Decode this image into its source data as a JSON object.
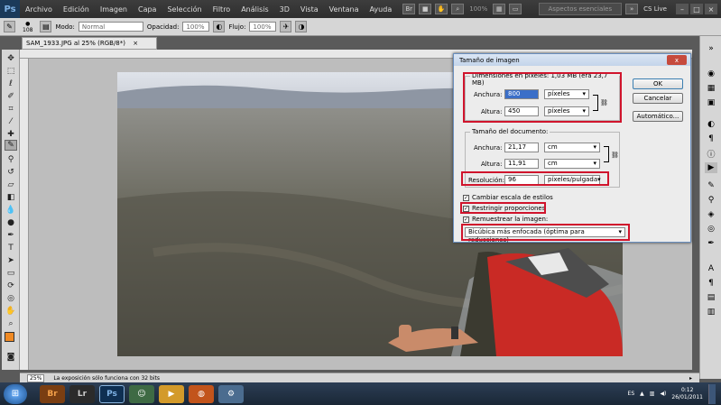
{
  "menu": {
    "app_logo": "Ps",
    "items": [
      "Archivo",
      "Edición",
      "Imagen",
      "Capa",
      "Selección",
      "Filtro",
      "Análisis",
      "3D",
      "Vista",
      "Ventana",
      "Ayuda"
    ],
    "zoom_readout": "100%",
    "workspace": "Aspectos esenciales",
    "cs_live": "CS Live"
  },
  "options": {
    "brush_size": "108",
    "mode_label": "Modo:",
    "mode_value": "Normal",
    "opacity_label": "Opacidad:",
    "opacity_value": "100%",
    "flow_label": "Flujo:",
    "flow_value": "100%"
  },
  "document": {
    "tab_title": "SAM_1933.JPG al 25% (RGB/8*)",
    "tab_close": "×"
  },
  "status": {
    "zoom": "25%",
    "message": "La exposición sólo funciona con 32 bits"
  },
  "dialog": {
    "title": "Tamaño de imagen",
    "close": "x",
    "pixel_dims_label": "Dimensiones en píxeles:",
    "pixel_dims_value": "1,03 MB (era 23,7 MB)",
    "px_width_label": "Anchura:",
    "px_width_value": "800",
    "px_width_unit": "píxeles",
    "px_height_label": "Altura:",
    "px_height_value": "450",
    "px_height_unit": "píxeles",
    "doc_size_label": "Tamaño del documento:",
    "doc_width_label": "Anchura:",
    "doc_width_value": "21,17",
    "doc_width_unit": "cm",
    "doc_height_label": "Altura:",
    "doc_height_value": "11,91",
    "doc_height_unit": "cm",
    "resolution_label": "Resolución:",
    "resolution_value": "96",
    "resolution_unit": "píxeles/pulgada",
    "scale_styles": "Cambiar escala de estilos",
    "constrain": "Restringir proporciones",
    "resample": "Remuestrear la imagen:",
    "resample_method": "Bicúbica más enfocada (óptima para reducciones)",
    "ok": "OK",
    "cancel": "Cancelar",
    "auto": "Automático..."
  },
  "taskbar": {
    "apps": [
      "Br",
      "Lr",
      "Ps"
    ],
    "lang": "ES",
    "time": "0:12",
    "date": "26/01/2011"
  },
  "colors": {
    "highlight": "#d0142c",
    "foreground": "#f08a24",
    "background": "#ffffff"
  }
}
